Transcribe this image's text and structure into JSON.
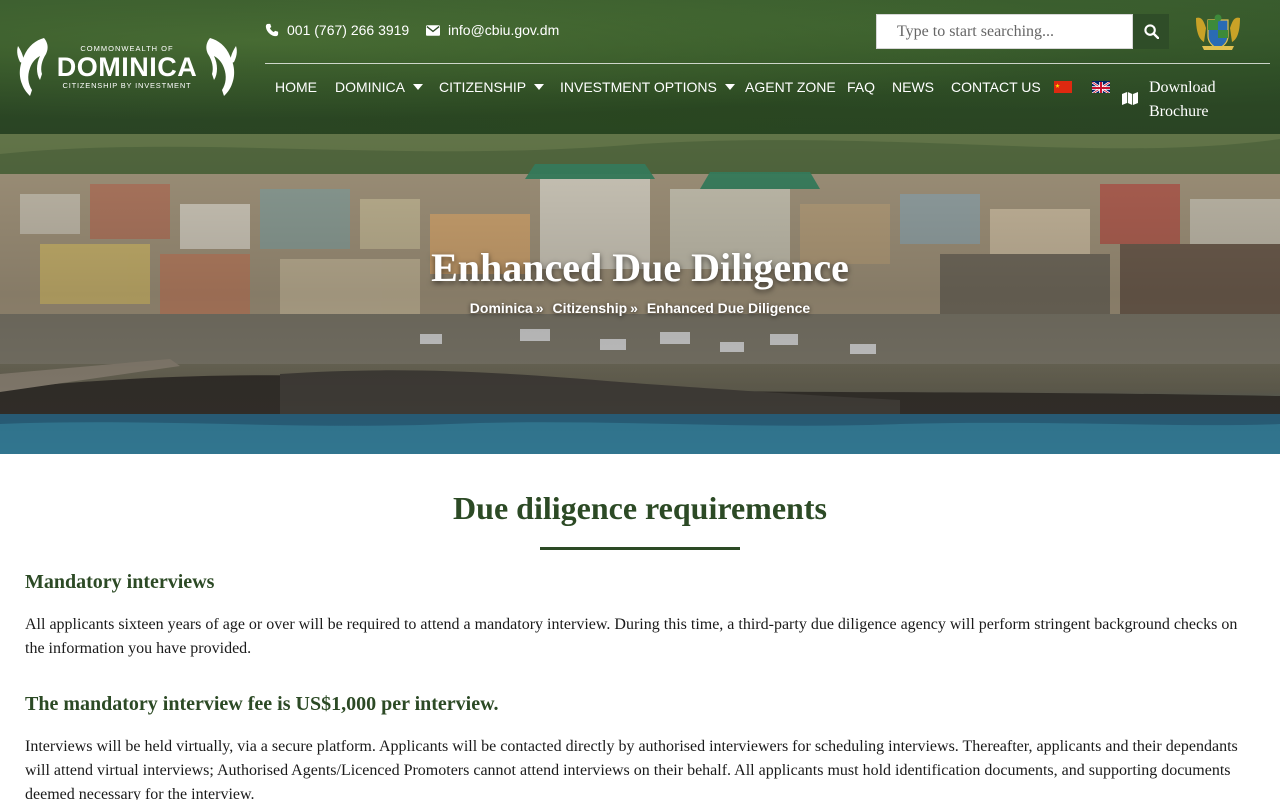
{
  "header": {
    "logo": {
      "top_text": "COMMONWEALTH OF",
      "name": "DOMINICA",
      "tagline": "CITIZENSHIP BY INVESTMENT"
    },
    "phone": "001 (767) 266 3919",
    "email": "info@cbiu.gov.dm",
    "search_placeholder": "Type to start searching...",
    "nav": [
      {
        "label": "HOME"
      },
      {
        "label": "DOMINICA"
      },
      {
        "label": "CITIZENSHIP"
      },
      {
        "label": "INVESTMENT OPTIONS"
      },
      {
        "label": "AGENT ZONE"
      },
      {
        "label": "FAQ"
      },
      {
        "label": "NEWS"
      },
      {
        "label": "CONTACT US"
      }
    ],
    "download_label": "Download Brochure"
  },
  "hero": {
    "title": "Enhanced Due Diligence",
    "breadcrumb": {
      "crumb1": "Dominica",
      "crumb2": "Citizenship",
      "current": "Enhanced Due Diligence",
      "separator": "»"
    }
  },
  "content": {
    "section_title": "Due diligence requirements",
    "subhead1": "Mandatory interviews",
    "para1": "All applicants sixteen years of age or over will be required to attend a mandatory interview. During this time, a third-party due diligence agency will perform stringent background checks on the information you have provided.",
    "subhead2": "The mandatory interview fee is US$1,000 per interview.",
    "para2": "Interviews will be held virtually, via a secure platform. Applicants will be contacted directly by authorised interviewers for scheduling interviews. Thereafter, applicants and their dependants will attend virtual interviews; Authorised Agents/Licenced Promoters cannot attend interviews on their behalf. All applicants must hold identification documents, and supporting documents deemed necessary for the interview."
  },
  "colors": {
    "brand_green": "#2c4a25",
    "nav_text": "#ffffff",
    "flag_cn": "#de2910",
    "flag_uk": "#012169"
  },
  "icons": [
    "phone-icon",
    "envelope-icon",
    "search-icon",
    "map-icon",
    "coat-of-arms-icon",
    "parrot-icon"
  ]
}
